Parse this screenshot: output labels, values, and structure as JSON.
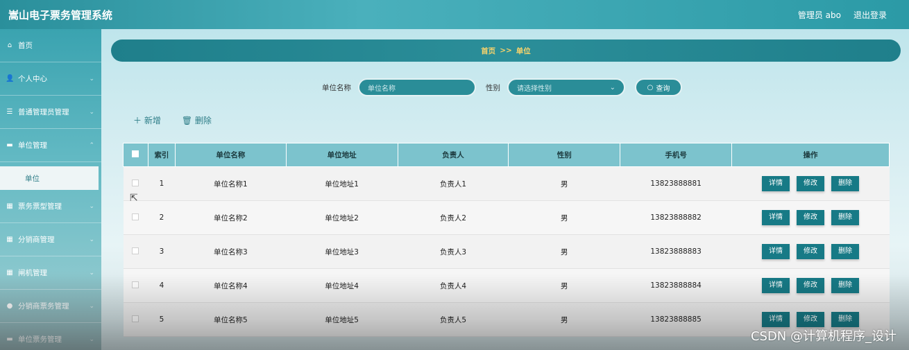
{
  "header": {
    "title": "嵩山电子票务管理系统",
    "user": "管理员 abo",
    "logout": "退出登录"
  },
  "sidebar": {
    "items": [
      {
        "label": "首页",
        "icon": "home-icon",
        "glyph": "⌂"
      },
      {
        "label": "个人中心",
        "icon": "user-icon",
        "glyph": "👤"
      },
      {
        "label": "普通管理员管理",
        "icon": "list-icon",
        "glyph": "☰"
      },
      {
        "label": "单位管理",
        "icon": "monitor-icon",
        "glyph": "▬"
      },
      {
        "label": "票务票型管理",
        "icon": "grid-icon",
        "glyph": "▦"
      },
      {
        "label": "分销商管理",
        "icon": "grid-icon",
        "glyph": "▦"
      },
      {
        "label": "闸机管理",
        "icon": "grid-icon",
        "glyph": "▦"
      },
      {
        "label": "分销商票务管理",
        "icon": "location-icon",
        "glyph": "●"
      },
      {
        "label": "单位票务管理",
        "icon": "monitor-icon",
        "glyph": "▬"
      }
    ],
    "sub_item": "单位"
  },
  "breadcrumb": {
    "home": "首页",
    "sep": ">>",
    "current": "单位"
  },
  "search": {
    "name_label": "单位名称",
    "name_placeholder": "单位名称",
    "gender_label": "性别",
    "gender_placeholder": "请选择性别",
    "query_button": "查询"
  },
  "actions": {
    "add": "新增",
    "delete": "删除"
  },
  "table": {
    "headers": [
      "索引",
      "单位名称",
      "单位地址",
      "负责人",
      "性别",
      "手机号",
      "操作"
    ],
    "rows": [
      {
        "index": "1",
        "name": "单位名称1",
        "address": "单位地址1",
        "manager": "负责人1",
        "gender": "男",
        "phone": "13823888881"
      },
      {
        "index": "2",
        "name": "单位名称2",
        "address": "单位地址2",
        "manager": "负责人2",
        "gender": "男",
        "phone": "13823888882"
      },
      {
        "index": "3",
        "name": "单位名称3",
        "address": "单位地址3",
        "manager": "负责人3",
        "gender": "男",
        "phone": "13823888883"
      },
      {
        "index": "4",
        "name": "单位名称4",
        "address": "单位地址4",
        "manager": "负责人4",
        "gender": "男",
        "phone": "13823888884"
      },
      {
        "index": "5",
        "name": "单位名称5",
        "address": "单位地址5",
        "manager": "负责人5",
        "gender": "男",
        "phone": "13823888885"
      }
    ],
    "row_buttons": {
      "detail": "详情",
      "edit": "修改",
      "remove": "删除"
    }
  },
  "watermark": "CSDN @计算机程序_设计"
}
